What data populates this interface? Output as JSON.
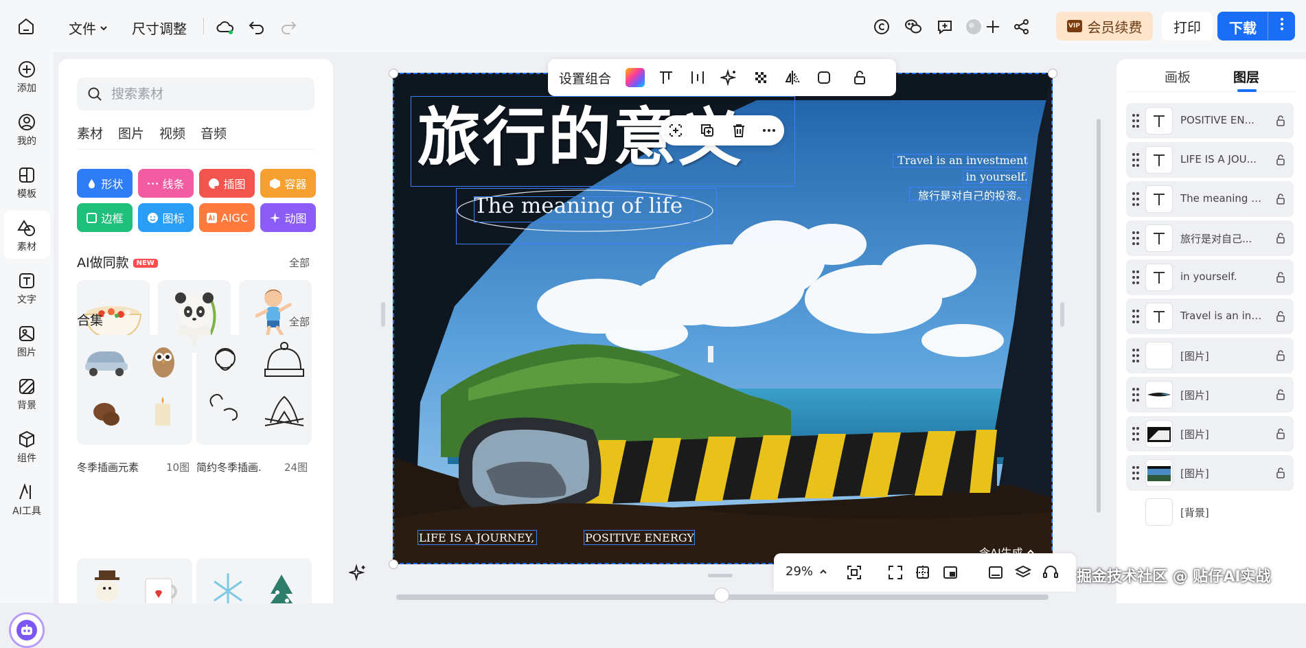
{
  "topbar": {
    "file_menu": "文件",
    "resize_menu": "尺寸调整",
    "vip_button": "会员续费",
    "vip_badge": "VIP",
    "print_button": "打印",
    "download_button": "下载"
  },
  "left_nav": {
    "items": [
      {
        "label": "添加",
        "icon": "plus-circle-icon"
      },
      {
        "label": "我的",
        "icon": "user-icon"
      },
      {
        "label": "模板",
        "icon": "template-icon"
      },
      {
        "label": "素材",
        "icon": "shapes-icon"
      },
      {
        "label": "文字",
        "icon": "text-icon"
      },
      {
        "label": "图片",
        "icon": "image-icon"
      },
      {
        "label": "背景",
        "icon": "background-icon"
      },
      {
        "label": "组件",
        "icon": "component-icon"
      },
      {
        "label": "AI工具",
        "icon": "ai-tool-icon"
      }
    ],
    "active": "素材"
  },
  "asset_panel": {
    "search_placeholder": "搜索素材",
    "tabs": [
      "素材",
      "图片",
      "视频",
      "音频"
    ],
    "chips": [
      {
        "label": "形状",
        "color": "#2e7cf6"
      },
      {
        "label": "线条",
        "color": "#f25ca2"
      },
      {
        "label": "插图",
        "color": "#f2554e"
      },
      {
        "label": "容器",
        "color": "#f5a030"
      },
      {
        "label": "边框",
        "color": "#1fbf7c"
      },
      {
        "label": "图标",
        "color": "#2a9df4"
      },
      {
        "label": "AIGC",
        "color": "#ff7a3c"
      },
      {
        "label": "动图",
        "color": "#8b5cf6"
      }
    ],
    "ai_section": {
      "title": "AI做同款",
      "badge": "NEW",
      "more": "全部"
    },
    "collection_section": {
      "title": "合集",
      "more": "全部"
    },
    "collections": [
      {
        "name": "冬季插画元素",
        "count": "10图"
      },
      {
        "name": "简约冬季插画...",
        "count": "24图"
      }
    ]
  },
  "canvas": {
    "title": "旅行的意义",
    "subtitle": "The meaning of life",
    "right_line1": "Travel is an investment",
    "right_line2": "in yourself.",
    "right_line3": "旅行是对自己的投资。",
    "bottom_left": "LIFE IS A JOURNEY,",
    "bottom_right": "POSITIVE ENERGY",
    "ai_generated": "含AI生成"
  },
  "float_toolbar": {
    "label": "设置组合"
  },
  "bottom_toolbar": {
    "zoom": "29%"
  },
  "right_panel": {
    "tabs": [
      "画板",
      "图层"
    ],
    "active_tab": "图层",
    "layers": [
      {
        "name": "POSITIVE EN...",
        "type": "text"
      },
      {
        "name": "LIFE IS A JOU...",
        "type": "text"
      },
      {
        "name": "The meaning o...",
        "type": "text"
      },
      {
        "name": "旅行是对自己...",
        "type": "text"
      },
      {
        "name": "in yourself.",
        "type": "text"
      },
      {
        "name": "Travel is an inv...",
        "type": "text"
      },
      {
        "name": "[图片]",
        "type": "image"
      },
      {
        "name": "[图片]",
        "type": "image"
      },
      {
        "name": "[图片]",
        "type": "image"
      },
      {
        "name": "[图片]",
        "type": "image"
      },
      {
        "name": "[背景]",
        "type": "background"
      }
    ]
  },
  "watermark": "掘金技术社区 @ 贴仔AI实战"
}
